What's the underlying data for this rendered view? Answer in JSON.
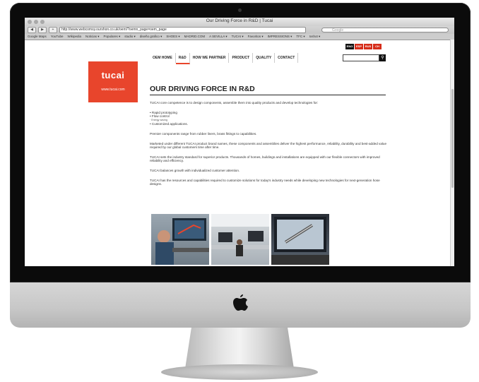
{
  "browser": {
    "window_title": "Our Driving Force in R&D | Tucai",
    "url": "http://www.webcomsy.ourshon.co.uk/oem/?oemn_page=oem_page",
    "search_placeholder": "Google",
    "bookmarks": [
      "Google Maps",
      "YouTube",
      "Wikipedia",
      "Noticias ▾",
      "Populares ▾",
      "studio ▾",
      "diseño grafico ▾",
      "SHOES ▾",
      "MADRID.COM",
      "A SEVILLA ▾",
      "TUCAI ▾",
      "Favoritos ▾",
      "IMPRESSIONS ▾",
      "TFC ▾",
      "Ixshot ▾"
    ]
  },
  "site": {
    "logo_word": "tucai",
    "logo_url": "www.tucai.com",
    "nav": [
      "OEM HOME",
      "R&D",
      "HOW WE PARTNER",
      "PRODUCT",
      "QUALITY",
      "CONTACT"
    ],
    "langs": [
      "ENG",
      "ESP",
      "RUS",
      "CH"
    ],
    "heading": "OUR DRIVING FORCE IN R&D",
    "intro": "TUCAI core competence is to design components, assemble them into quality products and develop technologies for:",
    "bullets": [
      "• Rapid prototyping",
      "• Flow control",
      "· Energy saving",
      "• Customized applications."
    ],
    "p1": "Premier components range from rubber liners, brass fittings to capabilities.",
    "p2": "Marketed under different TUCAI product brand names, these components and assemblies deliver the highest performance, reliability, durability and best-added value required by our global customers time after time.",
    "p3": "TUCAI sets the industry standard for superior products. Thousands of homes, buildings and installations are equipped with our flexible connectors with improved reliability and efficiency.",
    "p4": "TUCAI balances growth with individualized customer attention.",
    "p5": "TUCAI has the resources and capabilities required to customize solutions for today's industry needs while developing new technologies for next-generation hose designs."
  }
}
